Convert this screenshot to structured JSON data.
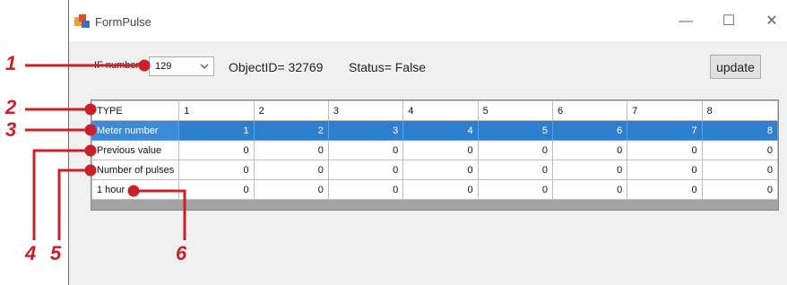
{
  "window": {
    "title": "FormPulse",
    "minimize_glyph": "—",
    "maximize_glyph": "☐",
    "close_glyph": "✕"
  },
  "toolbar": {
    "if_label": "IF number=",
    "if_value": "129",
    "object_id": "ObjectID= 32769",
    "status": "Status= False",
    "update_label": "update"
  },
  "grid": {
    "header": [
      "TYPE",
      "1",
      "2",
      "3",
      "4",
      "5",
      "6",
      "7",
      "8"
    ],
    "rows": [
      {
        "label": "Meter number",
        "values": [
          "1",
          "2",
          "3",
          "4",
          "5",
          "6",
          "7",
          "8"
        ],
        "selected": true
      },
      {
        "label": "Previous value",
        "values": [
          "0",
          "0",
          "0",
          "0",
          "0",
          "0",
          "0",
          "0"
        ]
      },
      {
        "label": "Number of pulses",
        "values": [
          "0",
          "0",
          "0",
          "0",
          "0",
          "0",
          "0",
          "0"
        ]
      },
      {
        "label": "1 hour",
        "values": [
          "0",
          "0",
          "0",
          "0",
          "0",
          "0",
          "0",
          "0"
        ]
      }
    ]
  },
  "callouts": [
    "1",
    "2",
    "3",
    "4",
    "5",
    "6"
  ],
  "colors": {
    "callout": "#cc1f2a",
    "selection": "#2f7fd1"
  }
}
